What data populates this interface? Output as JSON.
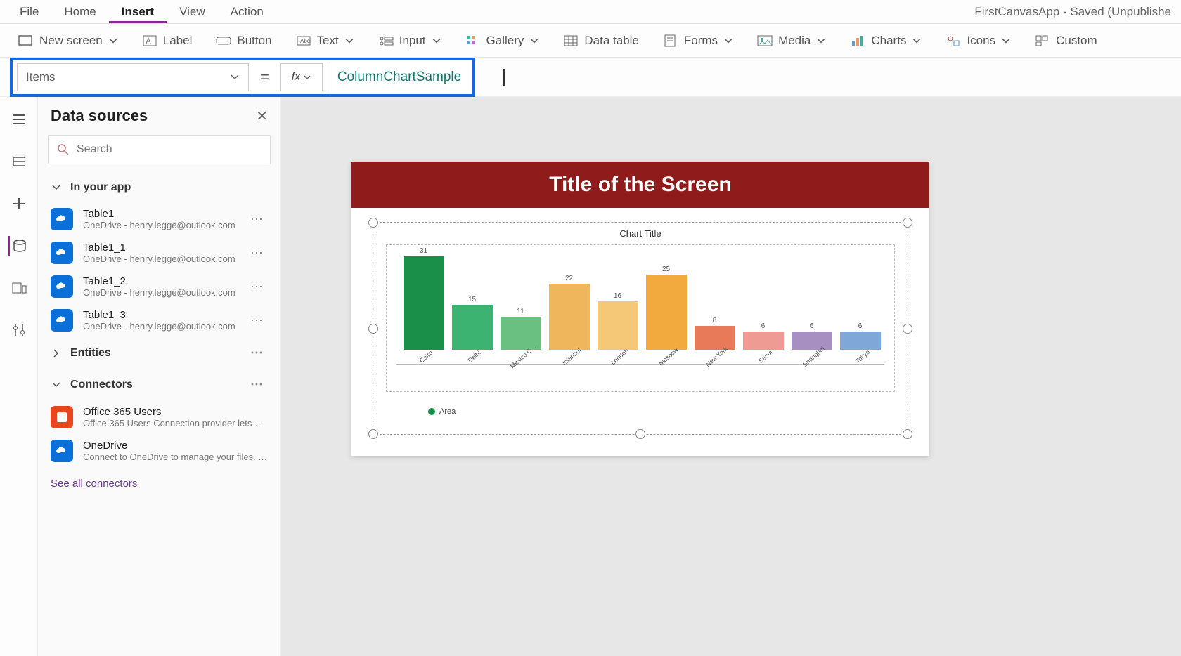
{
  "app_title": "FirstCanvasApp - Saved (Unpublishe",
  "menu": {
    "items": [
      "File",
      "Home",
      "Insert",
      "View",
      "Action"
    ],
    "active": 2
  },
  "ribbon": {
    "new_screen": "New screen",
    "label": "Label",
    "button": "Button",
    "text": "Text",
    "input": "Input",
    "gallery": "Gallery",
    "data_table": "Data table",
    "forms": "Forms",
    "media": "Media",
    "charts": "Charts",
    "icons": "Icons",
    "custom": "Custom"
  },
  "formula": {
    "property": "Items",
    "value": "ColumnChartSample"
  },
  "panel": {
    "title": "Data sources",
    "search_placeholder": "Search",
    "sections": {
      "in_your_app": "In your app",
      "entities": "Entities",
      "connectors": "Connectors"
    },
    "tables": [
      {
        "name": "Table1",
        "sub": "OneDrive - henry.legge@outlook.com"
      },
      {
        "name": "Table1_1",
        "sub": "OneDrive - henry.legge@outlook.com"
      },
      {
        "name": "Table1_2",
        "sub": "OneDrive - henry.legge@outlook.com"
      },
      {
        "name": "Table1_3",
        "sub": "OneDrive - henry.legge@outlook.com"
      }
    ],
    "connectors_list": [
      {
        "name": "Office 365 Users",
        "sub": "Office 365 Users Connection provider lets you ..."
      },
      {
        "name": "OneDrive",
        "sub": "Connect to OneDrive to manage your files. Yo..."
      }
    ],
    "see_all": "See all connectors"
  },
  "screen": {
    "title": "Title of the Screen",
    "chart_title": "Chart Title",
    "legend": "Area"
  },
  "chart_data": {
    "type": "bar",
    "title": "Chart Title",
    "categories": [
      "Cairo",
      "Delhi",
      "Mexico C...",
      "Istanbul",
      "London",
      "Moscow",
      "New York",
      "Seoul",
      "Shanghai",
      "Tokyo"
    ],
    "values": [
      31,
      15,
      11,
      22,
      16,
      25,
      8,
      6,
      6,
      6
    ],
    "colors": [
      "#1a8f4a",
      "#3cb371",
      "#6ac081",
      "#f0b65b",
      "#f5c878",
      "#f2a93e",
      "#e87a5a",
      "#ee9b93",
      "#a88fc2",
      "#7fa8d9"
    ],
    "legend": "Area",
    "ylim": [
      0,
      35
    ]
  }
}
